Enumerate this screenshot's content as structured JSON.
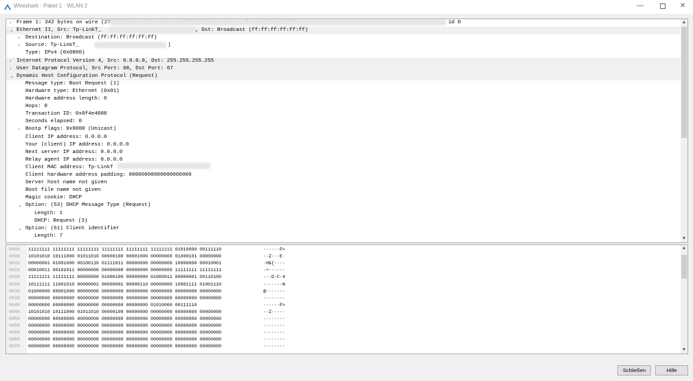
{
  "window": {
    "title": "Wireshark · Paket 1 · WLAN 2",
    "icon": "wireshark-fin-icon",
    "minimize": "—",
    "close": "✕"
  },
  "tree": [
    {
      "indent": 0,
      "arrow": "right",
      "hl": false,
      "text": "Frame 1: 342 bytes on wire (2736 bits), 342 captured (2736 bits) on interface \\Device\\NPF_"
    },
    {
      "indent": 0,
      "arrow": "down",
      "hl": true,
      "text": "Ethernet II, Src: Tp-LinkT_"
    },
    {
      "indent": 1,
      "arrow": "right",
      "hl": false,
      "text": "Destination: Broadcast (ff:ff:ff:ff:ff:ff)"
    },
    {
      "indent": 1,
      "arrow": "right",
      "hl": false,
      "text": "Source: Tp-LinkT_"
    },
    {
      "indent": 1,
      "arrow": "none",
      "hl": false,
      "text": "Type: IPv4 (0x0800)"
    },
    {
      "indent": 0,
      "arrow": "right",
      "hl": true,
      "text": "Internet Protocol Version 4, Src: 0.0.0.0, Dst: 255.255.255.255"
    },
    {
      "indent": 0,
      "arrow": "right",
      "hl": true,
      "text": "User Datagram Protocol, Src Port: 68, Dst Port: 67"
    },
    {
      "indent": 0,
      "arrow": "down",
      "hl": true,
      "text": "Dynamic Host Configuration Protocol (Request)"
    },
    {
      "indent": 1,
      "arrow": "none",
      "hl": false,
      "text": "Message type: Boot Request (1)"
    },
    {
      "indent": 1,
      "arrow": "none",
      "hl": false,
      "text": "Hardware type: Ethernet (0x01)"
    },
    {
      "indent": 1,
      "arrow": "none",
      "hl": false,
      "text": "Hardware address length: 6"
    },
    {
      "indent": 1,
      "arrow": "none",
      "hl": false,
      "text": "Hops: 0"
    },
    {
      "indent": 1,
      "arrow": "none",
      "hl": false,
      "text": "Transaction ID: 0x8f4e4008"
    },
    {
      "indent": 1,
      "arrow": "none",
      "hl": false,
      "text": "Seconds elapsed: 0"
    },
    {
      "indent": 1,
      "arrow": "right",
      "hl": false,
      "text": "Bootp flags: 0x0000 (Unicast)"
    },
    {
      "indent": 1,
      "arrow": "none",
      "hl": false,
      "text": "Client IP address: 0.0.0.0"
    },
    {
      "indent": 1,
      "arrow": "none",
      "hl": false,
      "text": "Your (client) IP address: 0.0.0.0"
    },
    {
      "indent": 1,
      "arrow": "none",
      "hl": false,
      "text": "Next server IP address: 0.0.0.0"
    },
    {
      "indent": 1,
      "arrow": "none",
      "hl": false,
      "text": "Relay agent IP address: 0.0.0.0"
    },
    {
      "indent": 1,
      "arrow": "none",
      "hl": false,
      "text": "Client MAC address: Tp-LinkT"
    },
    {
      "indent": 1,
      "arrow": "none",
      "hl": false,
      "text": "Client hardware address padding: 00000000000000000000"
    },
    {
      "indent": 1,
      "arrow": "none",
      "hl": false,
      "text": "Server host name not given"
    },
    {
      "indent": 1,
      "arrow": "none",
      "hl": false,
      "text": "Boot file name not given"
    },
    {
      "indent": 1,
      "arrow": "none",
      "hl": false,
      "text": "Magic cookie: DHCP"
    },
    {
      "indent": 1,
      "arrow": "down",
      "hl": false,
      "text": "Option: (53) DHCP Message Type (Request)"
    },
    {
      "indent": 2,
      "arrow": "none",
      "hl": false,
      "text": "Length: 1"
    },
    {
      "indent": 2,
      "arrow": "none",
      "hl": false,
      "text": "DHCP: Request (3)"
    },
    {
      "indent": 1,
      "arrow": "down",
      "hl": false,
      "text": "Option: (61) Client identifier"
    },
    {
      "indent": 2,
      "arrow": "none",
      "hl": false,
      "text": "Length: 7"
    }
  ],
  "tree_extras": {
    "frame_tail": "id 0",
    "eth_mid": ", Dst: Broadcast (ff:ff:ff:ff:ff:ff)",
    "source_tail": ")"
  },
  "hex": [
    {
      "offset": "0000",
      "bits": "11111111 11111111 11111111 11111111 11111111 11111111 01010000 00111110",
      "ascii": "······P>"
    },
    {
      "offset": "0008",
      "bits": "10101010 10111000 01011010 00000100 00001000 00000000 01000101 00000000",
      "ascii": "··Z···E·"
    },
    {
      "offset": "0010",
      "bits": "00000001 01001000 00100110 01111011 00000000 00000000 10000000 00010001",
      "ascii": "·H&{····"
    },
    {
      "offset": "0018",
      "bits": "00010011 00101011 00000000 00000000 00000000 00000000 11111111 11111111",
      "ascii": "·+······"
    },
    {
      "offset": "0020",
      "bits": "11111111 11111111 00000000 01000100 00000000 01000011 00000001 00110100",
      "ascii": "···D·C·4"
    },
    {
      "offset": "0028",
      "bits": "10111111 11001010 00000001 00000001 00000110 00000000 10001111 01001110",
      "ascii": "·······N"
    },
    {
      "offset": "0030",
      "bits": "01000000 00001000 00000000 00000000 00000000 00000000 00000000 00000000",
      "ascii": "@·······"
    },
    {
      "offset": "0038",
      "bits": "00000000 00000000 00000000 00000000 00000000 00000000 00000000 00000000",
      "ascii": "········"
    },
    {
      "offset": "0040",
      "bits": "00000000 00000000 00000000 00000000 00000000 01010000 00111110",
      "ascii": "······P>"
    },
    {
      "offset": "0048",
      "bits": "10101010 10111000 01011010 00000100 00000000 00000000 00000000 00000000",
      "ascii": "··Z·····"
    },
    {
      "offset": "0050",
      "bits": "00000000 00000000 00000000 00000000 00000000 00000000 00000000 00000000",
      "ascii": "········"
    },
    {
      "offset": "0058",
      "bits": "00000000 00000000 00000000 00000000 00000000 00000000 00000000 00000000",
      "ascii": "········"
    },
    {
      "offset": "0060",
      "bits": "00000000 00000000 00000000 00000000 00000000 00000000 00000000 00000000",
      "ascii": "········"
    },
    {
      "offset": "0068",
      "bits": "00000000 00000000 00000000 00000000 00000000 00000000 00000000 00000000",
      "ascii": "········"
    },
    {
      "offset": "0070",
      "bits": "00000000 00000000 00000000 00000000 00000000 00000000 00000000 00000000",
      "ascii": "········"
    }
  ],
  "buttons": {
    "close": "Schließen",
    "help": "Hilfe"
  },
  "scroll": {
    "up": "▲",
    "down": "▼"
  }
}
